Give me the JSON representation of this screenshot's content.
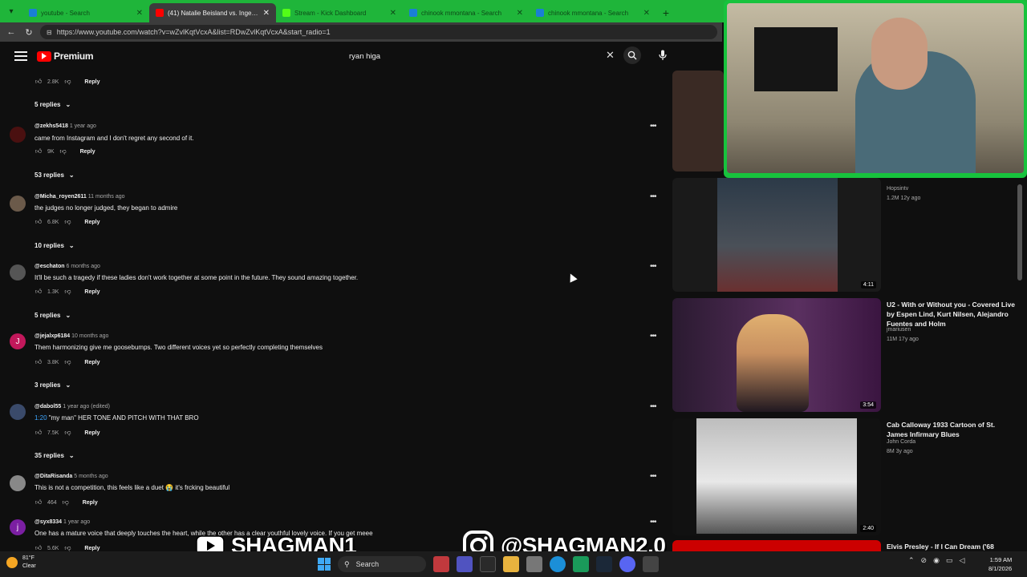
{
  "browser": {
    "tabs": [
      {
        "title": "youtube - Search",
        "active": false,
        "favicon_color": "#1a7fd4"
      },
      {
        "title": "(41) Natalie Beisland vs. Ingeborg",
        "active": true,
        "favicon_color": "#ff0000"
      },
      {
        "title": "Stream - Kick Dashboard",
        "active": false,
        "favicon_color": "#53fc18"
      },
      {
        "title": "chinook mmontana - Search",
        "active": false,
        "favicon_color": "#1a7fd4"
      },
      {
        "title": "chinook mmontana - Search",
        "active": false,
        "favicon_color": "#1a7fd4"
      }
    ],
    "url": "https://www.youtube.com/watch?v=wZvlKqtVcxA&list=RDwZvlKqtVcxA&start_radio=1"
  },
  "youtube": {
    "logo_text": "Premium",
    "search_value": "ryan higa"
  },
  "comments": [
    {
      "avatar": "",
      "avatar_color": "#333",
      "handle": "",
      "ago": "",
      "text": "",
      "likes": "2.8K",
      "replies": "5 replies"
    },
    {
      "avatar": "",
      "avatar_color": "#4a1010",
      "handle": "@zekhs5418",
      "ago": "1 year ago",
      "text": "came from Instagram and I don't regret any second of it.",
      "likes": "9K",
      "replies": "53 replies"
    },
    {
      "avatar": "",
      "avatar_color": "#6b5a4a",
      "handle": "@Micha_royen2611",
      "ago": "11 months ago",
      "text": "the judges no longer judged, they began to admire",
      "likes": "6.8K",
      "replies": "10 replies"
    },
    {
      "avatar": "",
      "avatar_color": "#555",
      "handle": "@eschaton",
      "ago": "6 months ago",
      "text": "It'll be such a tragedy if these ladies don't work together at some point in the future. They sound amazing together.",
      "likes": "1.3K",
      "replies": "5 replies"
    },
    {
      "avatar": "J",
      "avatar_color": "#c2185b",
      "handle": "@jejalxp6184",
      "ago": "10 months ago",
      "text": "Them harmonizing give me goosebumps. Two different voices yet so perfectly completing themselves",
      "likes": "3.8K",
      "replies": "3 replies"
    },
    {
      "avatar": "",
      "avatar_color": "#3a4a6a",
      "handle": "@dabol55",
      "ago": "1 year ago (edited)",
      "timestamp": "1:20",
      "text": " \"my man\" HER TONE AND PITCH WITH THAT BRO",
      "likes": "7.5K",
      "replies": "35 replies"
    },
    {
      "avatar": "",
      "avatar_color": "#888",
      "handle": "@DitaRisanda",
      "ago": "5 months ago",
      "text": "This is not a competition, this feels like a duet 😭 it's frcking beautiful",
      "likes": "464",
      "replies": ""
    },
    {
      "avatar": "j",
      "avatar_color": "#7b1fa2",
      "handle": "@syx8334",
      "ago": "1 year ago",
      "text": "One has a mature voice that deeply touches the heart, while the other has a clear youthful lovely voice. If you get meee",
      "likes": "5.6K",
      "replies": ""
    }
  ],
  "comment_actions": {
    "reply": "Reply"
  },
  "related": [
    {
      "title": "",
      "channel": "Hopsintv",
      "meta": "1.2M  12y ago",
      "duration": "4:11",
      "thumb_color": "#2c3a48"
    },
    {
      "title": "U2 - With or Without you - Covered  Live by Espen Lind, Kurt Nilsen, Alejandro Fuentes and Holm",
      "channel": "jmariusen",
      "meta": "11M  17y ago",
      "duration": "3:54",
      "thumb_color": "#3a2240"
    },
    {
      "title": "Cab Calloway 1933 Cartoon of St. James Infirmary Blues",
      "channel": "John Corda",
      "meta": "8M  3y ago",
      "duration": "2:40",
      "thumb_color": "#cfcfcf"
    },
    {
      "title": "Elvis Presley - If I Can Dream ('68",
      "channel": "",
      "meta": "",
      "duration": "",
      "thumb_color": "#222"
    }
  ],
  "overlay": {
    "youtube_handle": "SHAGMAN1",
    "instagram_handle": "@SHAGMAN2.0"
  },
  "taskbar": {
    "temp": "81°F",
    "condition": "Clear",
    "search_label": "Search",
    "time": "1:59 AM",
    "date": "8/1/2026"
  }
}
